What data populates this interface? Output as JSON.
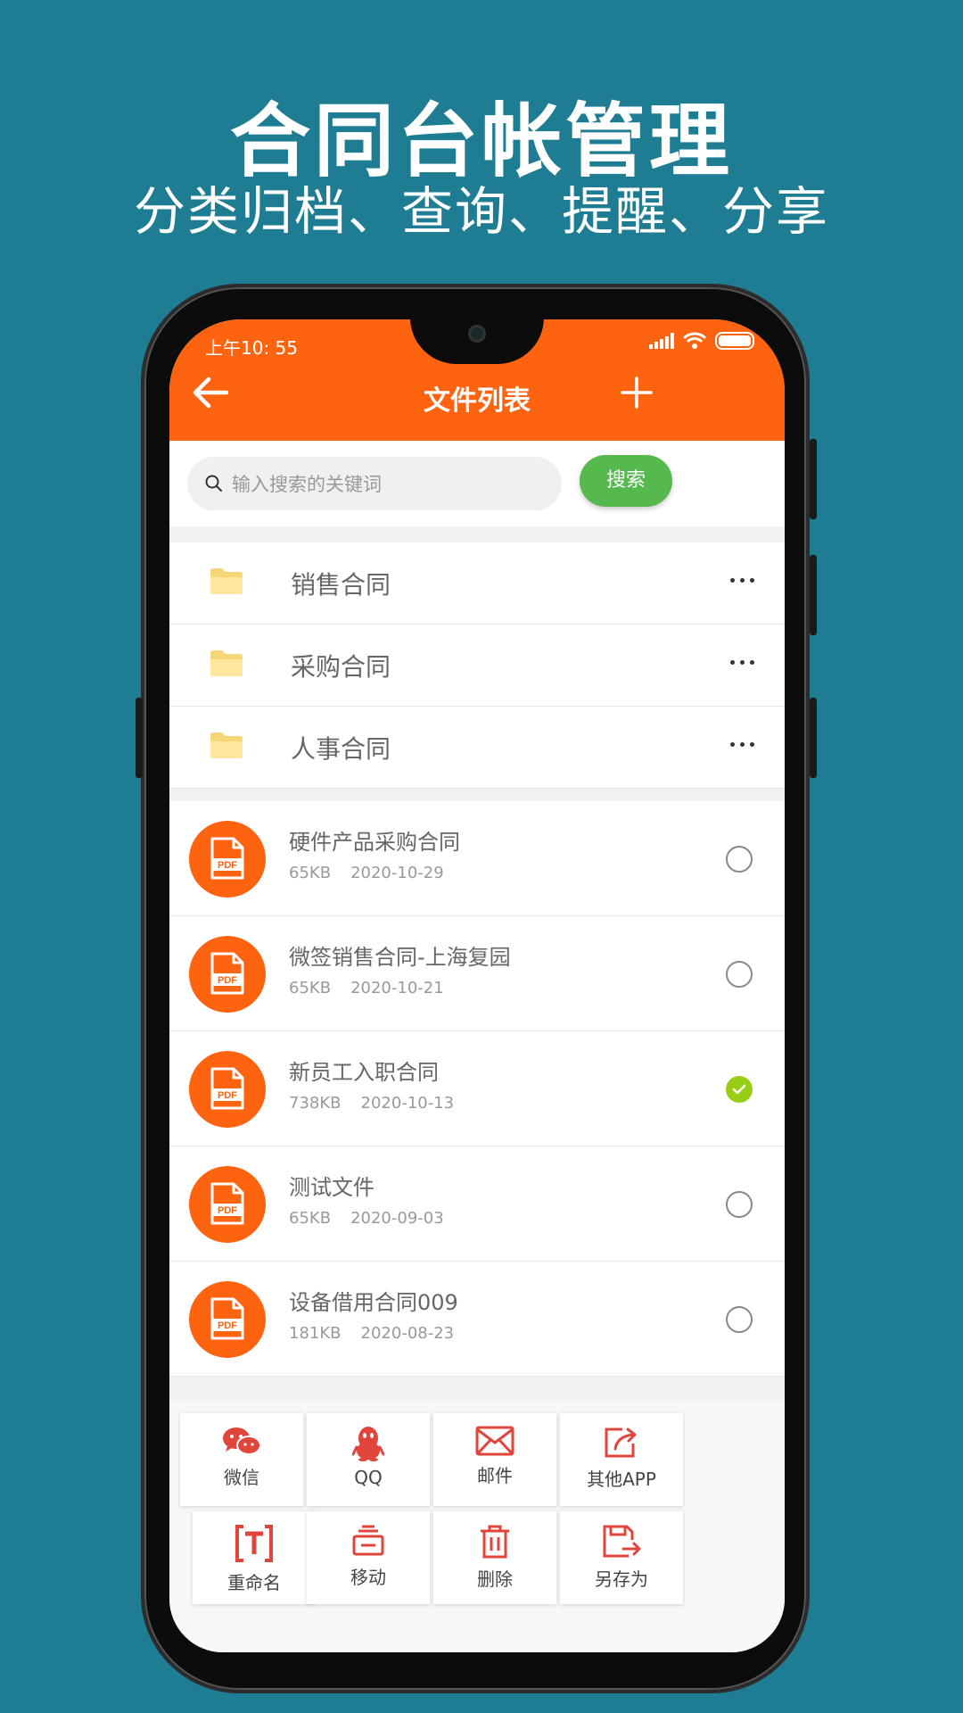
{
  "promo": {
    "title": "合同台帐管理",
    "subtitle": "分类归档、查询、提醒、分享"
  },
  "status_bar": {
    "time": "上午10: 55"
  },
  "header": {
    "title": "文件列表",
    "back_icon": "arrow-left-icon",
    "add_icon": "plus-icon"
  },
  "search": {
    "placeholder": "输入搜索的关键词",
    "button_label": "搜索"
  },
  "folders": [
    {
      "label": "销售合同"
    },
    {
      "label": "采购合同"
    },
    {
      "label": "人事合同"
    }
  ],
  "files": [
    {
      "name": "硬件产品采购合同",
      "size": "65KB",
      "date": "2020-10-29",
      "checked": false
    },
    {
      "name": "微签销售合同-上海复园",
      "size": "65KB",
      "date": "2020-10-21",
      "checked": false
    },
    {
      "name": "新员工入职合同",
      "size": "738KB",
      "date": "2020-10-13",
      "checked": true
    },
    {
      "name": "测试文件",
      "size": "65KB",
      "date": "2020-09-03",
      "checked": false
    },
    {
      "name": "设备借用合同009",
      "size": "181KB",
      "date": "2020-08-23",
      "checked": false
    }
  ],
  "share_actions": [
    {
      "label": "微信",
      "icon": "wechat-icon"
    },
    {
      "label": "QQ",
      "icon": "qq-icon"
    },
    {
      "label": "邮件",
      "icon": "mail-icon"
    },
    {
      "label": "其他APP",
      "icon": "share-icon"
    }
  ],
  "file_actions": [
    {
      "label": "重命名",
      "icon": "rename-icon"
    },
    {
      "label": "移动",
      "icon": "move-icon"
    },
    {
      "label": "删除",
      "icon": "trash-icon"
    },
    {
      "label": "另存为",
      "icon": "save-as-icon"
    }
  ],
  "colors": {
    "background": "#1f7d93",
    "accent": "#fe6310",
    "search_button": "#56b94d",
    "checked": "#9acd16",
    "action_icon": "#e0443a"
  }
}
